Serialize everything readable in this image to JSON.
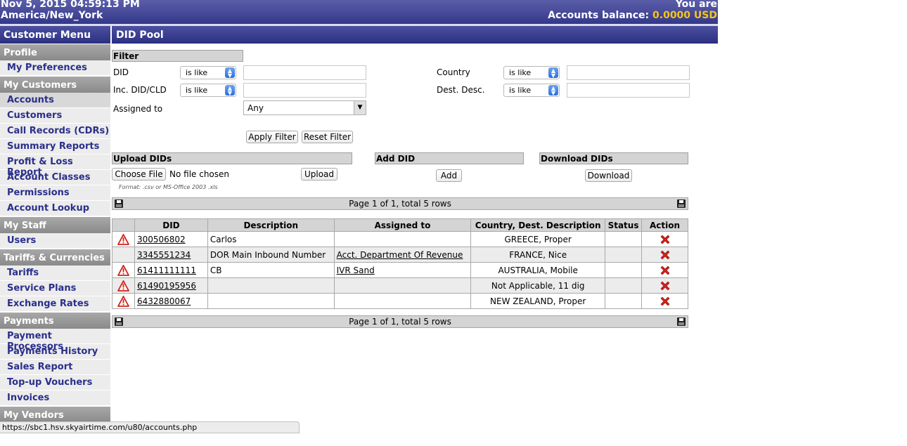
{
  "header": {
    "datetime": "Nov 5, 2015 04:59:13 PM",
    "timezone": "America/New_York",
    "you_are": "You are",
    "balance_label": "Accounts balance:",
    "balance_value": "0.0000 USD"
  },
  "sidebar": {
    "title": "Customer Menu",
    "sections": [
      {
        "label": "Profile",
        "items": [
          "My Preferences"
        ]
      },
      {
        "label": "My Customers",
        "items": [
          "Accounts",
          "Customers",
          "Call Records (CDRs)",
          "Summary Reports",
          "Profit & Loss Report",
          "Account Classes",
          "Permissions",
          "Account Lookup"
        ]
      },
      {
        "label": "My Staff",
        "items": [
          "Users"
        ]
      },
      {
        "label": "Tariffs & Currencies",
        "items": [
          "Tariffs",
          "Service Plans",
          "Exchange Rates"
        ]
      },
      {
        "label": "Payments",
        "items": [
          "Payment Processors",
          "Payments History",
          "Sales Report",
          "Top-up Vouchers",
          "Invoices"
        ]
      },
      {
        "label": "My Vendors",
        "items": []
      }
    ]
  },
  "page": {
    "title": "DID Pool",
    "filter": {
      "heading": "Filter",
      "did_label": "DID",
      "did_op": "is like",
      "inc_label": "Inc. DID/CLD",
      "inc_op": "is like",
      "assigned_label": "Assigned to",
      "assigned_value": "Any",
      "country_label": "Country",
      "country_op": "is like",
      "dest_label": "Dest. Desc.",
      "dest_op": "is like",
      "apply": "Apply Filter",
      "reset": "Reset Filter"
    },
    "upload": {
      "heading": "Upload DIDs",
      "choose": "Choose File",
      "no_file": "No file chosen",
      "button": "Upload",
      "format": "Format: .csv or MS-Office 2003 .xls"
    },
    "add": {
      "heading": "Add DID",
      "button": "Add"
    },
    "download": {
      "heading": "Download DIDs",
      "button": "Download"
    },
    "pager": "Page 1 of 1, total 5 rows",
    "table": {
      "headers": [
        "DID",
        "Description",
        "Assigned to",
        "Country, Dest. Description",
        "Status",
        "Action"
      ],
      "rows": [
        {
          "warn": true,
          "did": "300506802",
          "description": "Carlos",
          "assigned": "",
          "country": "GREECE, Proper",
          "status": ""
        },
        {
          "warn": false,
          "did": "3345551234",
          "description": "DOR Main Inbound Number",
          "assigned": "Acct. Department Of Revenue",
          "country": "FRANCE, Nice",
          "status": ""
        },
        {
          "warn": true,
          "did": "61411111111",
          "description": "CB",
          "assigned": "IVR Sand",
          "country": "AUSTRALIA, Mobile",
          "status": ""
        },
        {
          "warn": true,
          "did": "61490195956",
          "description": "",
          "assigned": "",
          "country": "Not Applicable, 11 dig",
          "status": ""
        },
        {
          "warn": true,
          "did": "6432880067",
          "description": "",
          "assigned": "",
          "country": "NEW ZEALAND, Proper",
          "status": ""
        }
      ]
    }
  },
  "statusbar": {
    "url": "https://sbc1.hsv.skyairtime.com/u80/accounts.php"
  },
  "colors": {
    "header_blue": "#34388a",
    "balance_yellow": "#f5c518",
    "link_blue": "#2a2f8a",
    "delete_red": "#d0201a",
    "warn_red": "#d0201a"
  }
}
